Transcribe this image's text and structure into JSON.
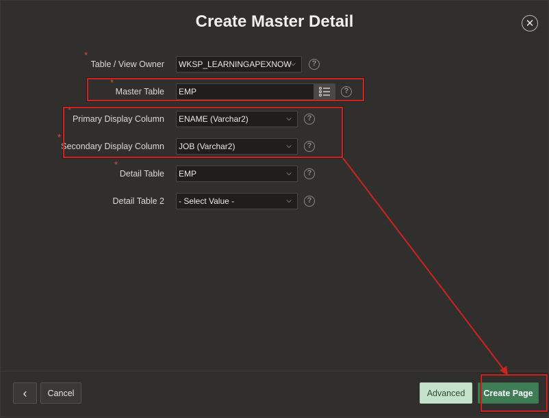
{
  "dialog": {
    "title": "Create Master Detail",
    "close_glyph": "✕"
  },
  "form": {
    "required_marker": "*",
    "help_glyph": "?",
    "chevron_glyph": "⌵",
    "owner": {
      "label": "Table / View Owner",
      "value": "WKSP_LEARNINGAPEXNOW"
    },
    "master_table": {
      "label": "Master Table",
      "value": "EMP"
    },
    "primary_display": {
      "label": "Primary Display Column",
      "value": "ENAME (Varchar2)"
    },
    "secondary_display": {
      "label": "Secondary Display Column",
      "value": "JOB (Varchar2)"
    },
    "detail_table": {
      "label": "Detail Table",
      "value": "EMP"
    },
    "detail_table2": {
      "label": "Detail Table 2",
      "value": "- Select Value -"
    }
  },
  "footer": {
    "back_glyph": "‹",
    "cancel_label": "Cancel",
    "advanced_label": "Advanced",
    "create_label": "Create Page"
  },
  "colors": {
    "background": "#312f2d",
    "annotation_red": "#d0231f",
    "primary_button": "#3f7d57",
    "secondary_button": "#c5e2cc",
    "required_star": "#e0493c"
  },
  "icons": {
    "close": "close-icon",
    "help": "help-icon",
    "list": "list-icon",
    "chevron": "chevron-down-icon",
    "back": "chevron-left-icon"
  }
}
